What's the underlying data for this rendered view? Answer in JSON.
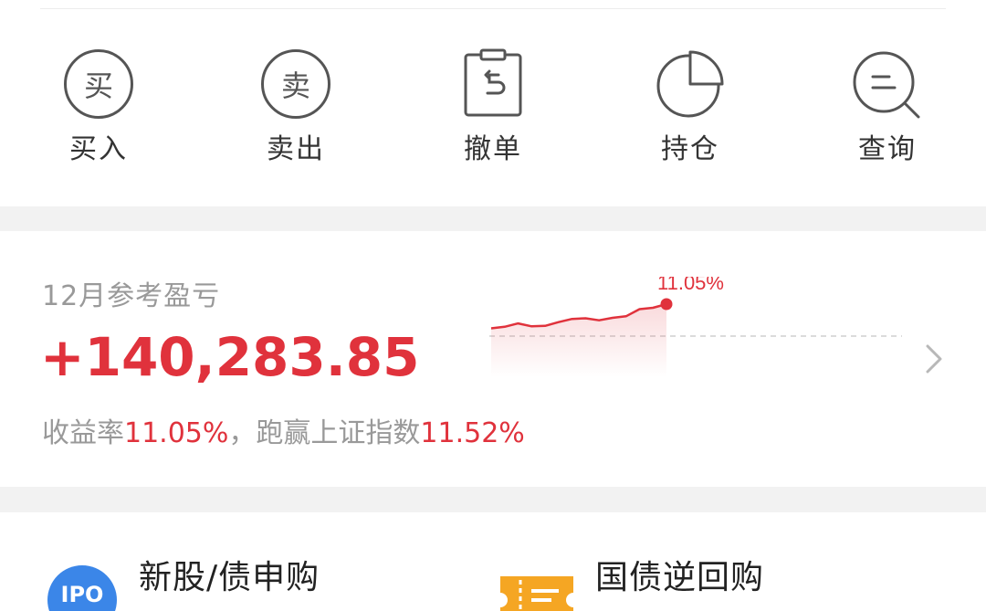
{
  "actions": [
    {
      "label": "买入",
      "icon": "buy-circle-icon",
      "glyph": "买"
    },
    {
      "label": "卖出",
      "icon": "sell-circle-icon",
      "glyph": "卖"
    },
    {
      "label": "撤单",
      "icon": "clipboard-undo-icon"
    },
    {
      "label": "持仓",
      "icon": "pie-chart-icon"
    },
    {
      "label": "查询",
      "icon": "search-icon"
    }
  ],
  "profit": {
    "title": "12月参考盈亏",
    "amount": "+140,283.85",
    "return_label": "收益率",
    "return_value": "11.05%",
    "separator": "，",
    "beat_label": "跑赢上证指数",
    "beat_value": "11.52%",
    "chart_label": "11.05%"
  },
  "chart_data": {
    "type": "line",
    "series": [
      {
        "values": [
          0.2,
          0.9,
          2.4,
          1.1,
          1.3,
          3.0,
          4.4,
          4.7,
          3.8,
          4.9,
          5.6,
          8.8,
          9.4,
          11.05
        ]
      }
    ],
    "end_label": "11.05%"
  },
  "services": [
    {
      "label": "新股/债申购",
      "icon": "ipo-icon",
      "icon_text": "IPO"
    },
    {
      "label": "国债逆回购",
      "icon": "ticket-icon"
    }
  ],
  "colors": {
    "accent_red": "#e0323c",
    "ipo_blue": "#3b86e8",
    "ticket_orange": "#f5a623"
  }
}
